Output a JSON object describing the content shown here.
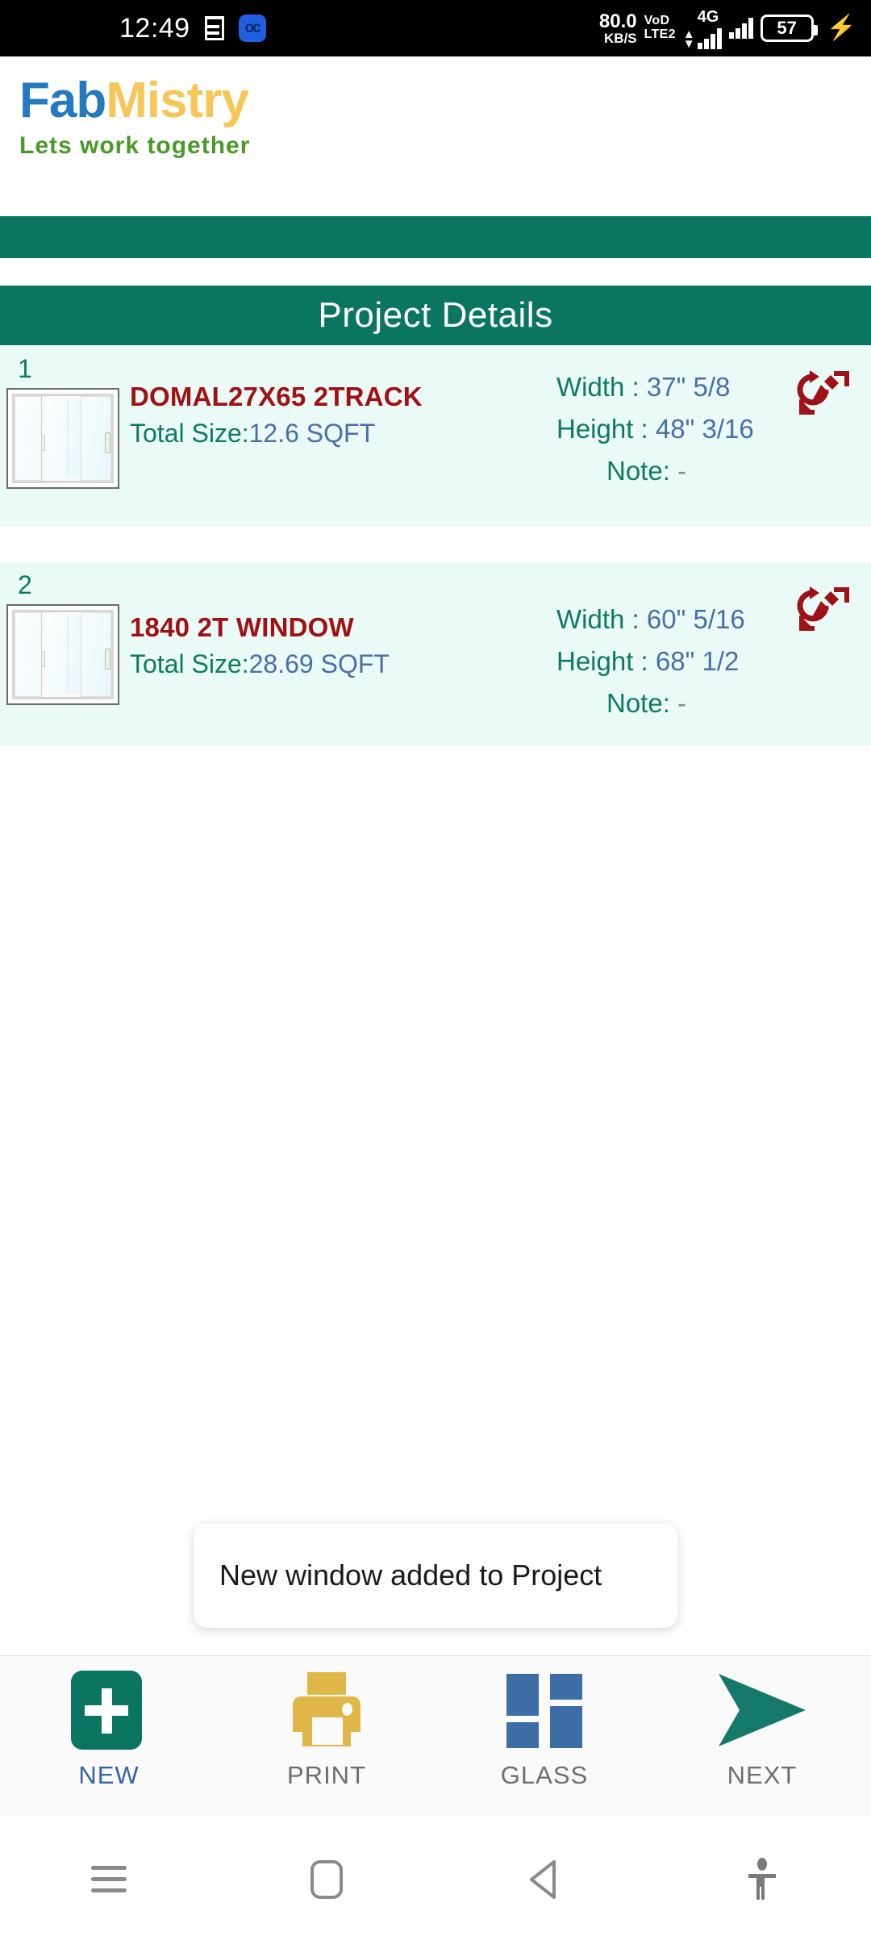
{
  "status_bar": {
    "time": "12:49",
    "doc_icon": "document-icon",
    "app_badge": "oc",
    "net_speed_value": "80.0",
    "net_speed_unit": "KB/S",
    "volte_line1": "VoD",
    "volte_line2": "LTE2",
    "network_type": "4G",
    "battery_percent": "57",
    "charging": true
  },
  "logo": {
    "part1": "Fab",
    "part2": "Mistry",
    "tagline": "Lets work together",
    "color_part1": "#2579c0",
    "color_part2": "#f7c659",
    "color_tagline": "#4a9a2a"
  },
  "header": {
    "title": "Project Details",
    "bg_color": "#0a7561"
  },
  "items": [
    {
      "number": "1",
      "name": "DOMAL27X65 2TRACK",
      "total_size_label": "Total Size:",
      "total_size_value": "12.6 SQFT",
      "width_label": "Width  :",
      "width_value": "37\" 5/8",
      "height_label": "Height :",
      "height_value": "48\" 3/16",
      "note_label": "Note:",
      "note_value": "-",
      "edit_icon": "edit-refresh-icon",
      "thumbnail": "sliding-window-thumbnail"
    },
    {
      "number": "2",
      "name": "1840 2T WINDOW",
      "total_size_label": "Total Size:",
      "total_size_value": "28.69 SQFT",
      "width_label": "Width  :",
      "width_value": "60\" 5/16",
      "height_label": "Height :",
      "height_value": "68\" 1/2",
      "note_label": "Note:",
      "note_value": "-",
      "edit_icon": "edit-refresh-icon",
      "thumbnail": "sliding-window-thumbnail"
    }
  ],
  "toast": {
    "message": "New window added to Project"
  },
  "bottom_nav": [
    {
      "label": "NEW",
      "icon": "plus-square-icon",
      "color": "#0a7561"
    },
    {
      "label": "PRINT",
      "icon": "printer-icon",
      "color": "#dfb648"
    },
    {
      "label": "GLASS",
      "icon": "glass-grid-icon",
      "color": "#3c6ea5"
    },
    {
      "label": "NEXT",
      "icon": "arrow-right-icon",
      "color": "#0a7561"
    }
  ],
  "android_nav": {
    "recents": "menu-icon",
    "home": "home-icon",
    "back": "back-icon",
    "accessibility": "accessibility-icon"
  }
}
